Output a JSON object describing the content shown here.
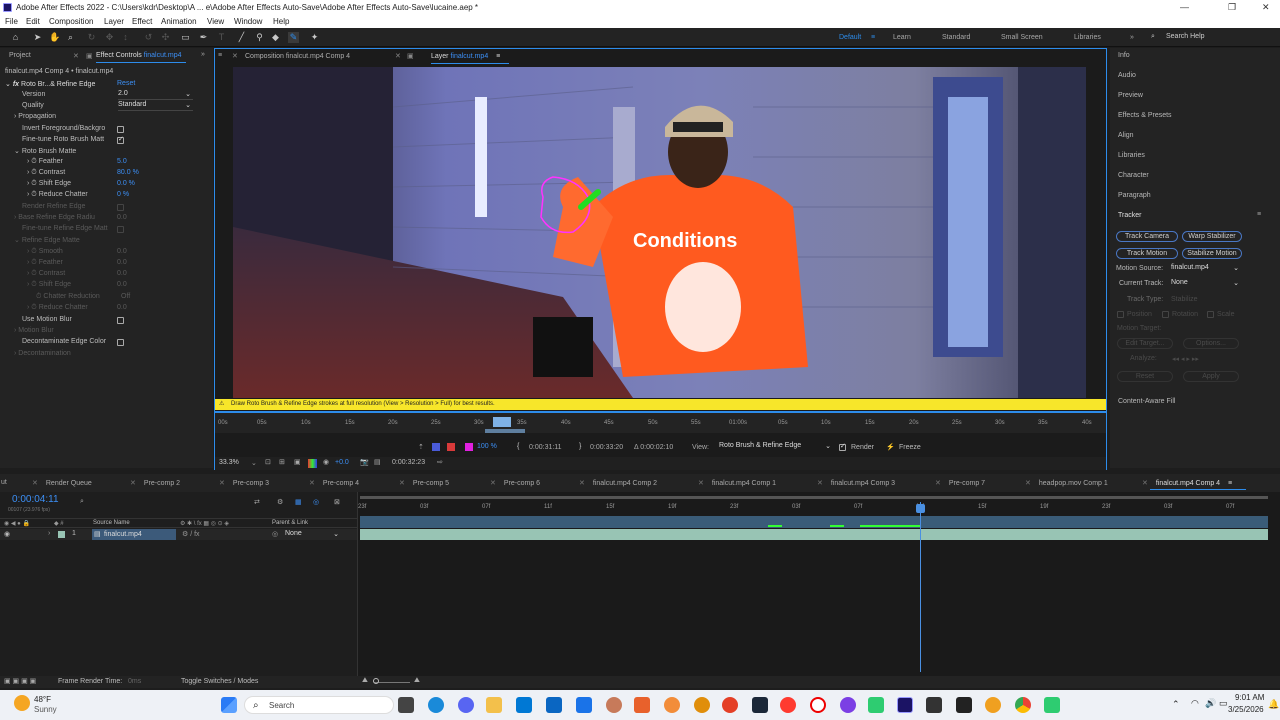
{
  "title_bar": {
    "title": "Adobe After Effects 2022 - C:\\Users\\kdr\\Desktop\\A ... e\\Adobe After Effects Auto-Save\\Adobe After Effects Auto-Save\\lucaine.aep *"
  },
  "menu": [
    "File",
    "Edit",
    "Composition",
    "Layer",
    "Effect",
    "Animation",
    "View",
    "Window",
    "Help"
  ],
  "workspaces": {
    "default": "Default",
    "learn": "Learn",
    "standard": "Standard",
    "small_screen": "Small Screen",
    "libraries": "Libraries",
    "search": "Search Help"
  },
  "left_panel": {
    "tab_project": "Project",
    "tab_effect_controls": "Effect Controls",
    "tab_effect_controls_file": "finalcut.mp4",
    "layer_path": "finalcut.mp4 Comp 4 • finalcut.mp4",
    "effect_name": "Roto Br...& Refine Edge",
    "reset": "Reset",
    "version_label": "Version",
    "version_value": "2.0",
    "quality_label": "Quality",
    "quality_value": "Standard",
    "propagation": "Propagation",
    "invert_fg": "Invert Foreground/Backgro",
    "fine_tune": "Fine-tune Roto Brush Matt",
    "roto_brush_matte": "Roto Brush Matte",
    "feather_label": "Feather",
    "feather_value": "5.0",
    "contrast_label": "Contrast",
    "contrast_value": "80.0 %",
    "shift_label": "Shift Edge",
    "shift_value": "0.0 %",
    "reduce_label": "Reduce Chatter",
    "reduce_value": "0 %",
    "render_refine": "Render Refine Edge",
    "base_refine": "Base Refine Edge Radiu",
    "fine_tune_refine": "Fine-tune Refine Edge Matt",
    "refine_edge_matte": "Refine Edge Matte",
    "smooth": "Smooth",
    "feather2": "Feather",
    "contrast2": "Contrast",
    "shift2": "Shift Edge",
    "chatter_reduction": "Chatter Reduction",
    "reduce2": "Reduce Chatter",
    "dim_zero": "0.0",
    "dim_off": "Off",
    "use_motion_blur": "Use Motion Blur",
    "motion_blur": "Motion Blur",
    "decontaminate": "Decontaminate Edge Color",
    "decontamination": "Decontamination"
  },
  "center": {
    "tab_comp": "Composition",
    "tab_comp_name": "finalcut.mp4 Comp 4",
    "tab_layer": "Layer",
    "tab_layer_name": "finalcut.mp4",
    "shirt_text": "Conditions",
    "warning": "Draw Roto Brush & Refine Edge strokes at full resolution (View > Resolution > Full) for best results.",
    "ruler": [
      "00s",
      "05s",
      "10s",
      "15s",
      "20s",
      "25s",
      "30s",
      "35s",
      "40s",
      "45s",
      "50s",
      "55s",
      "01:00s",
      "05s",
      "10s",
      "15s",
      "20s",
      "25s",
      "30s",
      "35s",
      "40s"
    ],
    "opacity": "100 %",
    "time_start": "0:00:31:11",
    "time_end": "0:00:33:20",
    "duration": "Δ 0:00:02:10",
    "view_label": "View:",
    "view_value": "Roto Brush & Refine Edge",
    "render_label": "Render",
    "freeze_label": "Freeze",
    "zoom": "33.3%",
    "exposure": "+0.0",
    "current_time": "0:00:32:23"
  },
  "right_panel": {
    "items": [
      "Info",
      "Audio",
      "Preview",
      "Effects & Presets",
      "Align",
      "Libraries",
      "Character",
      "Paragraph"
    ],
    "tracker": "Tracker",
    "track_camera": "Track Camera",
    "warp_stabilizer": "Warp Stabilizer",
    "track_motion": "Track Motion",
    "stabilize_motion": "Stabilize Motion",
    "motion_source_label": "Motion Source:",
    "motion_source_value": "finalcut.mp4",
    "current_track_label": "Current Track:",
    "current_track_value": "None",
    "track_type_label": "Track Type:",
    "track_type_value": "Stabilize",
    "position": "Position",
    "rotation": "Rotation",
    "scale": "Scale",
    "motion_target": "Motion Target:",
    "edit_target": "Edit Target...",
    "options": "Options...",
    "analyze": "Analyze:",
    "reset": "Reset",
    "apply": "Apply",
    "content_aware_fill": "Content-Aware Fill"
  },
  "timeline": {
    "tabs": [
      "ut",
      "Render Queue",
      "Pre-comp 2",
      "Pre-comp 3",
      "Pre-comp 4",
      "Pre-comp 5",
      "Pre-comp 6",
      "finalcut.mp4 Comp 2",
      "finalcut.mp4 Comp 1",
      "finalcut.mp4 Comp 3",
      "Pre-comp 7",
      "headpop.mov Comp 1",
      "finalcut.mp4 Comp 4"
    ],
    "timecode": "0:00:04:11",
    "fps": "00107 (23.976 fps)",
    "source_name_header": "Source Name",
    "parent_header": "Parent & Link",
    "layer_num": "1",
    "layer_name": "finalcut.mp4",
    "parent_value": "None",
    "ruler": [
      "23f",
      "03f",
      "07f",
      "11f",
      "15f",
      "19f",
      "23f",
      "03f",
      "07f",
      "11f",
      "15f",
      "19f",
      "23f",
      "03f",
      "07f"
    ],
    "frame_render_label": "Frame Render Time:",
    "frame_render_value": "0ms",
    "toggle_label": "Toggle Switches / Modes"
  },
  "taskbar": {
    "weather_temp": "48°F",
    "weather_desc": "Sunny",
    "search": "Search",
    "time": "9:01 AM",
    "date": "3/25/2026"
  },
  "colors": {
    "accent": "#2d8ceb",
    "warning": "#f7e62a",
    "layer_bar": "#98c4b4",
    "shirt": "#ff5a1f"
  }
}
